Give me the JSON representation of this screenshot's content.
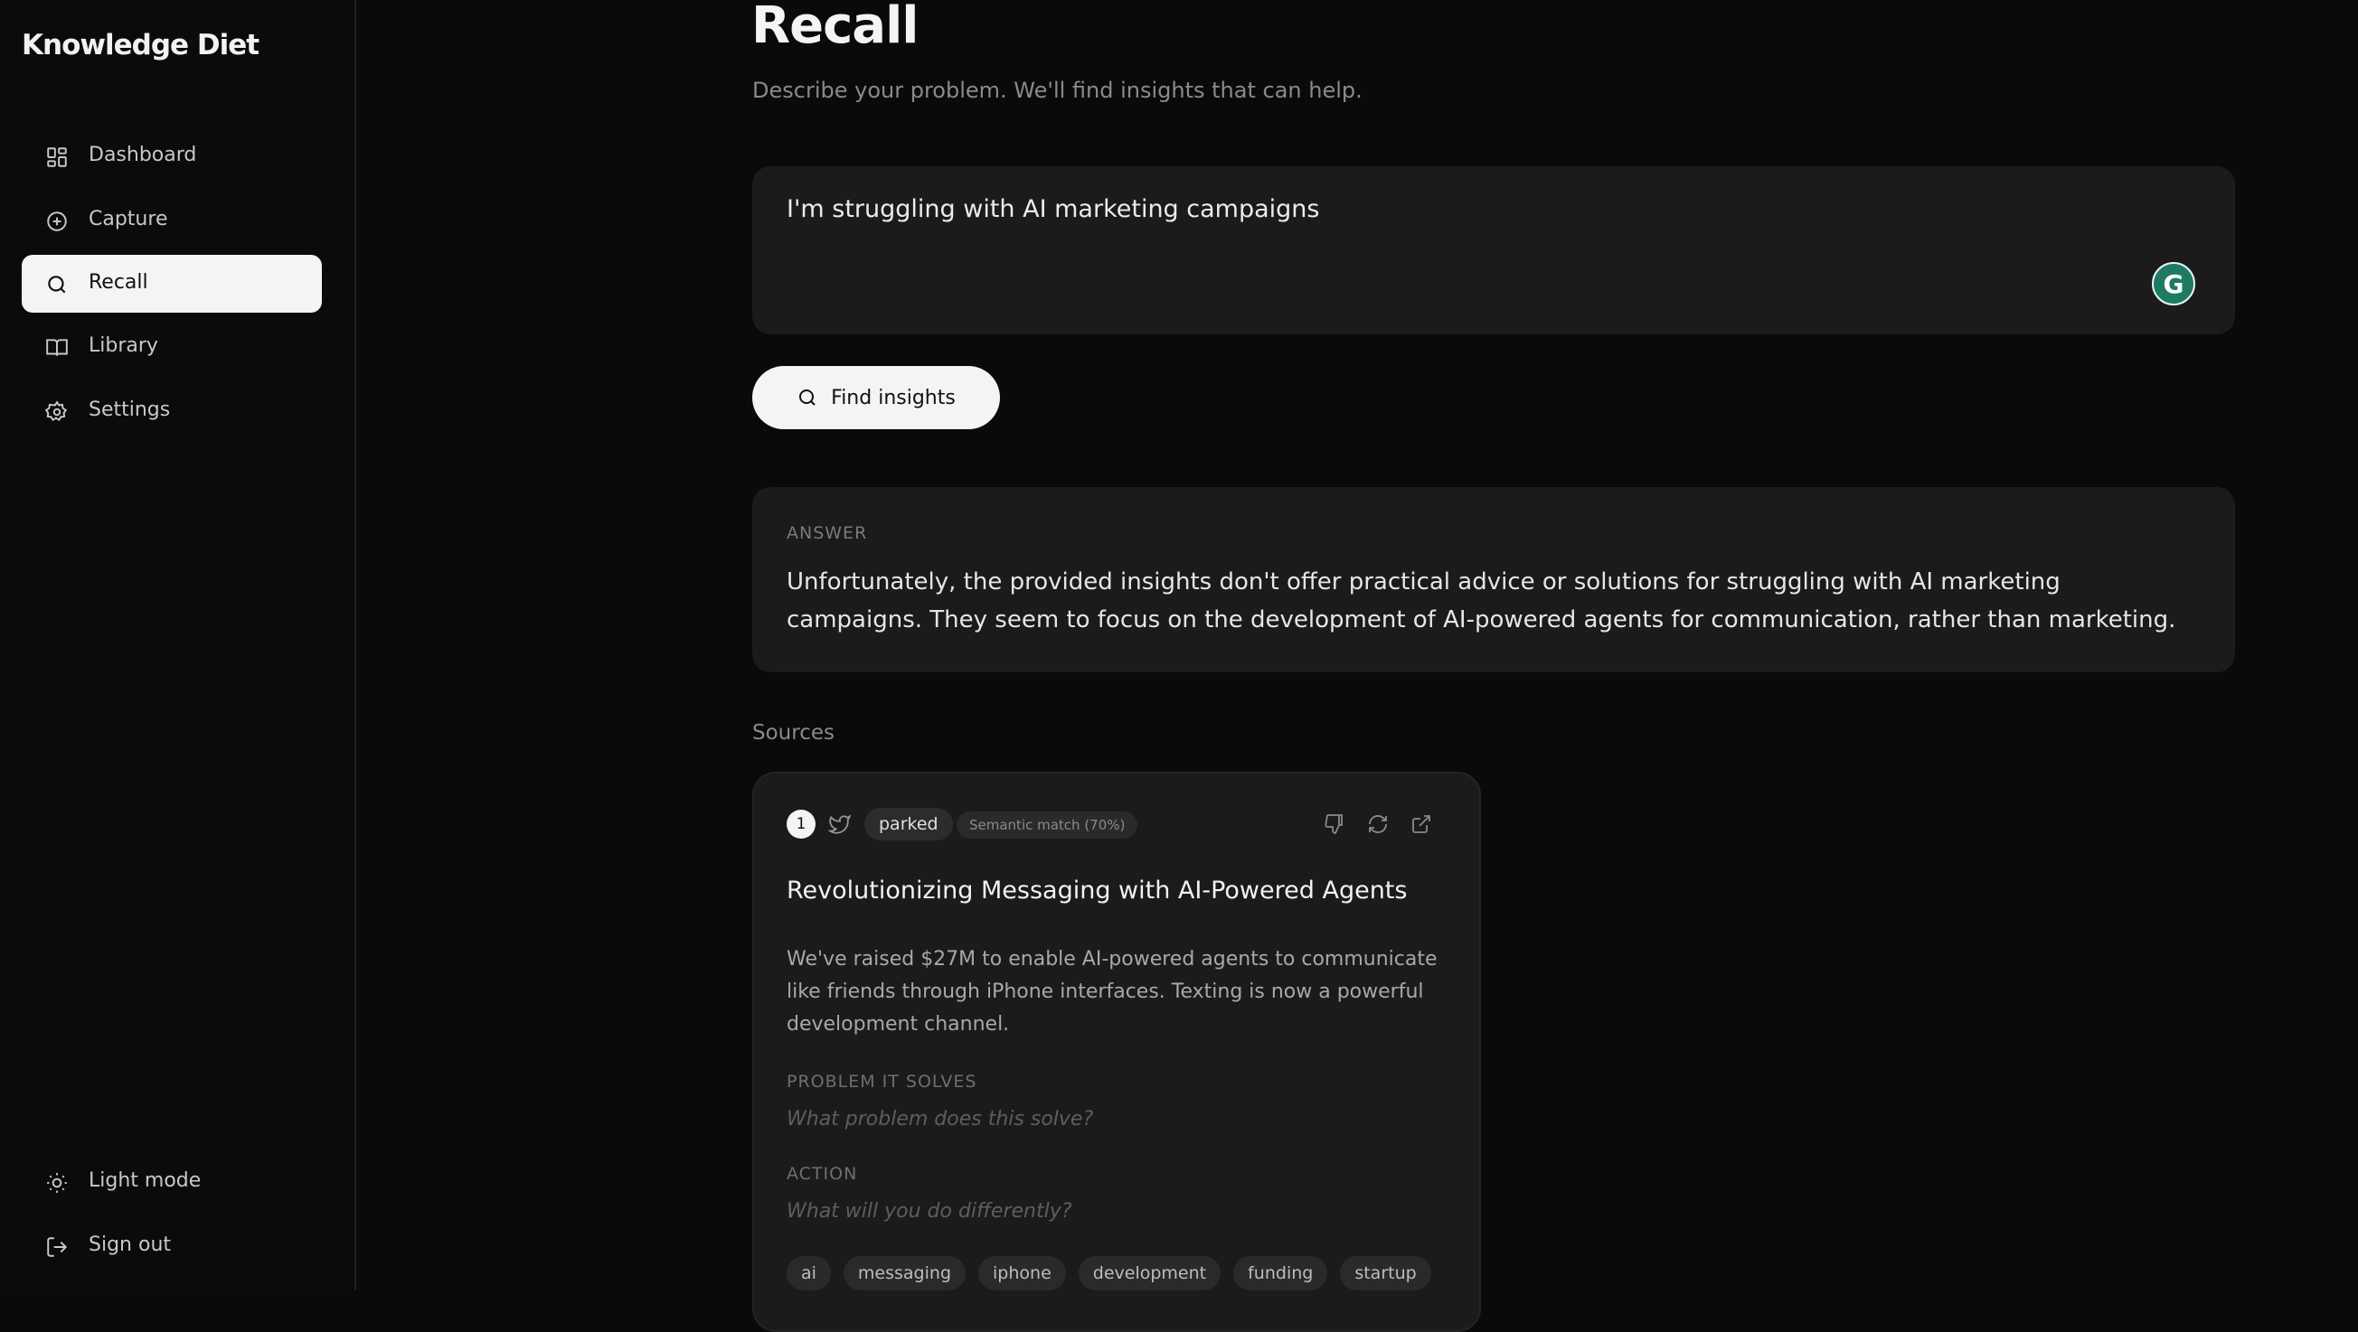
{
  "app": {
    "name": "Knowledge Diet"
  },
  "sidebar": {
    "items": [
      {
        "label": "Dashboard",
        "icon": "dashboard-icon"
      },
      {
        "label": "Capture",
        "icon": "plus-circle-icon"
      },
      {
        "label": "Recall",
        "icon": "search-icon",
        "active": true
      },
      {
        "label": "Library",
        "icon": "book-icon"
      },
      {
        "label": "Settings",
        "icon": "gear-icon"
      }
    ],
    "footer": [
      {
        "label": "Light mode",
        "icon": "sun-icon"
      },
      {
        "label": "Sign out",
        "icon": "logout-icon"
      }
    ]
  },
  "page": {
    "title": "Recall",
    "subtitle": "Describe your problem. We'll find insights that can help."
  },
  "query": {
    "value": "I'm struggling with AI marketing campaigns"
  },
  "find_button": {
    "label": "Find insights"
  },
  "answer": {
    "label": "ANSWER",
    "text": "Unfortunately, the provided insights don't offer practical advice or solutions for struggling with AI marketing campaigns. They seem to focus on the development of AI-powered agents for communication, rather than marketing."
  },
  "sources": {
    "label": "Sources",
    "items": [
      {
        "index": "1",
        "status": "parked",
        "match": "Semantic match (70%)",
        "title": "Revolutionizing Messaging with AI-Powered Agents",
        "description": "We've raised $27M to enable AI-powered agents to communicate like friends through iPhone interfaces. Texting is now a powerful development channel.",
        "problem_label": "PROBLEM IT SOLVES",
        "problem_placeholder": "What problem does this solve?",
        "action_label": "ACTION",
        "action_placeholder": "What will you do differently?",
        "tags": [
          "ai",
          "messaging",
          "iphone",
          "development",
          "funding",
          "startup"
        ]
      }
    ]
  },
  "colors": {
    "background": "#0a0a0a",
    "card": "#1b1b1b",
    "accent": "#f4f4f4",
    "grammarly": "#1f7a63"
  }
}
